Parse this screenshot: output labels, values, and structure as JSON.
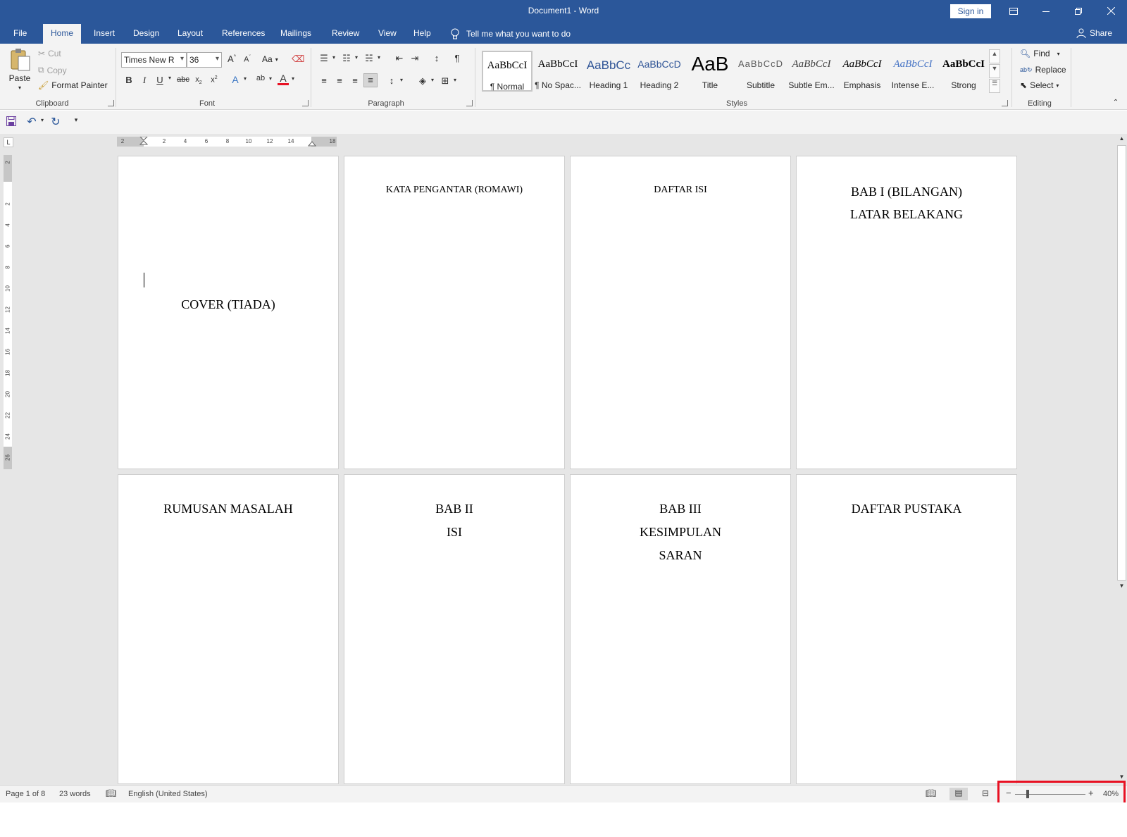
{
  "app": {
    "title": "Document1  -  Word",
    "sign_in": "Sign in",
    "share": "Share",
    "tell_me": "Tell me what you want to do"
  },
  "tabs": [
    "File",
    "Home",
    "Insert",
    "Design",
    "Layout",
    "References",
    "Mailings",
    "Review",
    "View",
    "Help"
  ],
  "ribbon": {
    "clipboard": {
      "label": "Clipboard",
      "paste": "Paste",
      "cut": "Cut",
      "copy": "Copy",
      "format_painter": "Format Painter"
    },
    "font": {
      "label": "Font",
      "family": "Times New R",
      "size": "36",
      "change_case": "Aa"
    },
    "paragraph": {
      "label": "Paragraph"
    },
    "styles": {
      "label": "Styles",
      "items": [
        {
          "preview": "AaBbCcI",
          "name": "¶ Normal"
        },
        {
          "preview": "AaBbCcI",
          "name": "¶ No Spac..."
        },
        {
          "preview": "AaBbCc",
          "name": "Heading 1"
        },
        {
          "preview": "AaBbCcD",
          "name": "Heading 2"
        },
        {
          "preview": "AaB",
          "name": "Title"
        },
        {
          "preview": "AaBbCcD",
          "name": "Subtitle"
        },
        {
          "preview": "AaBbCcI",
          "name": "Subtle Em..."
        },
        {
          "preview": "AaBbCcI",
          "name": "Emphasis"
        },
        {
          "preview": "AaBbCcI",
          "name": "Intense E..."
        },
        {
          "preview": "AaBbCcI",
          "name": "Strong"
        }
      ]
    },
    "editing": {
      "label": "Editing",
      "find": "Find",
      "replace": "Replace",
      "select": "Select"
    }
  },
  "ruler": {
    "h_ticks": [
      "2",
      "2",
      "4",
      "6",
      "8",
      "10",
      "12",
      "14",
      "18"
    ],
    "v_ticks": [
      "2",
      "2",
      "4",
      "6",
      "8",
      "10",
      "12",
      "14",
      "16",
      "18",
      "20",
      "22",
      "24",
      "26"
    ]
  },
  "pages": [
    {
      "lines": [
        "COVER (TIADA)"
      ]
    },
    {
      "lines": [
        "KATA PENGANTAR (ROMAWI)"
      ]
    },
    {
      "lines": [
        "DAFTAR ISI"
      ]
    },
    {
      "lines": [
        "BAB I (BILANGAN)",
        "LATAR BELAKANG"
      ]
    },
    {
      "lines": [
        "RUMUSAN MASALAH"
      ]
    },
    {
      "lines": [
        "BAB II",
        "ISI"
      ]
    },
    {
      "lines": [
        "BAB III",
        "KESIMPULAN",
        "SARAN"
      ]
    },
    {
      "lines": [
        "DAFTAR PUSTAKA"
      ]
    }
  ],
  "status": {
    "page": "Page 1 of 8",
    "words": "23 words",
    "language": "English (United States)",
    "zoom": "40%",
    "zoom_level": 0.4
  },
  "colors": {
    "brand": "#2b579a",
    "highlight": "#e81123"
  }
}
